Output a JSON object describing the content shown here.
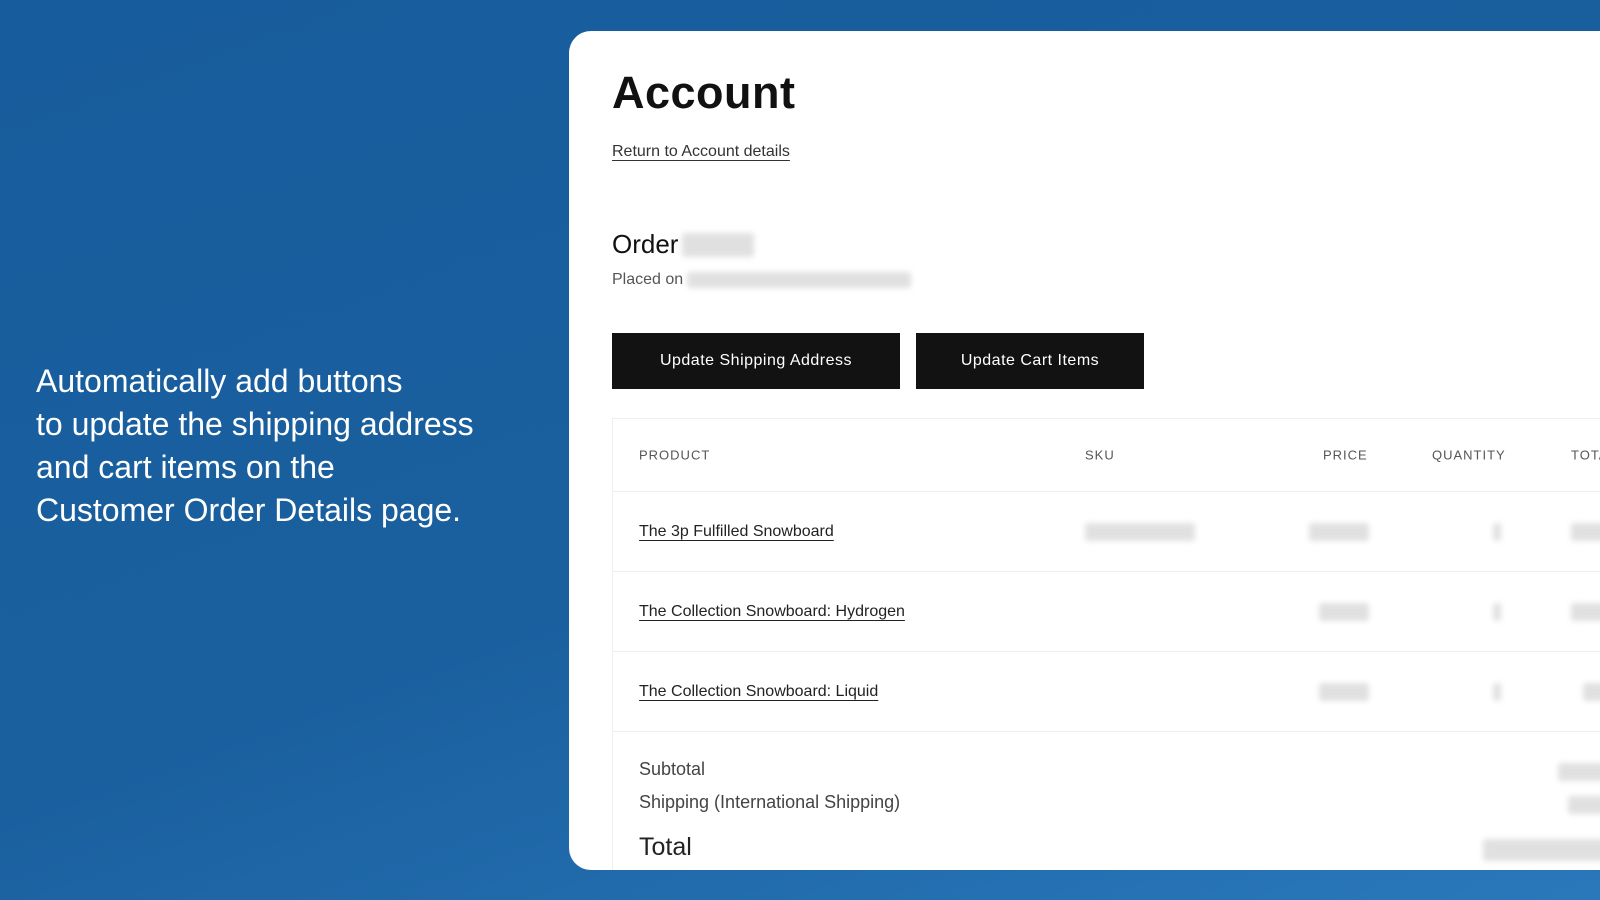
{
  "promo": {
    "lines": [
      "Automatically add buttons",
      "to update the shipping address",
      "and cart items on the",
      "Customer Order Details page."
    ]
  },
  "page": {
    "title": "Account",
    "return_link": "Return to Account details",
    "order_label": "Order",
    "placed_on_label": "Placed on",
    "buttons": {
      "update_shipping": "Update Shipping Address",
      "update_cart": "Update Cart Items"
    },
    "table": {
      "headers": {
        "product": "PRODUCT",
        "sku": "SKU",
        "price": "PRICE",
        "quantity": "QUANTITY",
        "total": "TOTAL"
      },
      "rows": [
        {
          "product": "The 3p Fulfilled Snowboard"
        },
        {
          "product": "The Collection Snowboard: Hydrogen"
        },
        {
          "product": "The Collection Snowboard: Liquid"
        }
      ],
      "summary": {
        "subtotal": "Subtotal",
        "shipping": "Shipping (International Shipping)",
        "total": "Total"
      }
    }
  }
}
